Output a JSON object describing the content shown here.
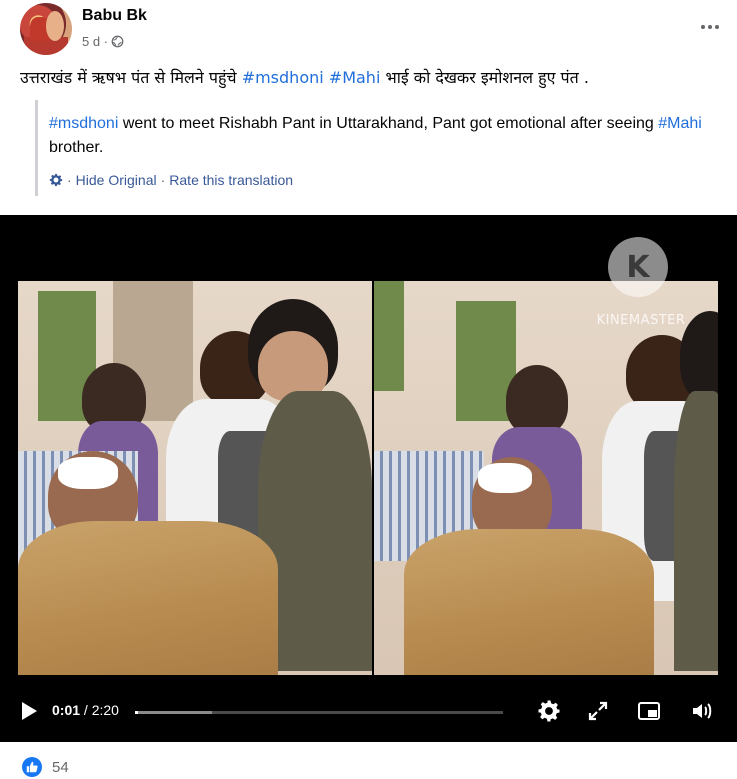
{
  "post": {
    "author": "Babu Bk",
    "time": "5 d ·",
    "text_hindi_prefix": "उत्तराखंड में ऋषभ पंत से मिलने पहुंचे ",
    "tag1": "#msdhoni",
    "tag2": "#Mahi",
    "text_hindi_suffix": "  भाई को देखकर इमोशनल हुए पंत ."
  },
  "translation": {
    "tag1": "#msdhoni",
    "text1": " went to meet Rishabh Pant in Uttarakhand, Pant got emotional after seeing ",
    "tag2": "#Mahi",
    "text2": " brother.",
    "hide_original": "Hide Original",
    "separator": "·",
    "rate": "Rate this translation"
  },
  "video": {
    "watermark_letter": "K",
    "watermark_text": "KINEMASTER",
    "current_time": "0:01",
    "duration": "/ 2:20",
    "progress_fraction": 0.007,
    "buffered_fraction": 0.21
  },
  "reactions": {
    "like_count": "54"
  },
  "colors": {
    "hashtag": "#216fdb",
    "like_blue": "#1877f2"
  }
}
